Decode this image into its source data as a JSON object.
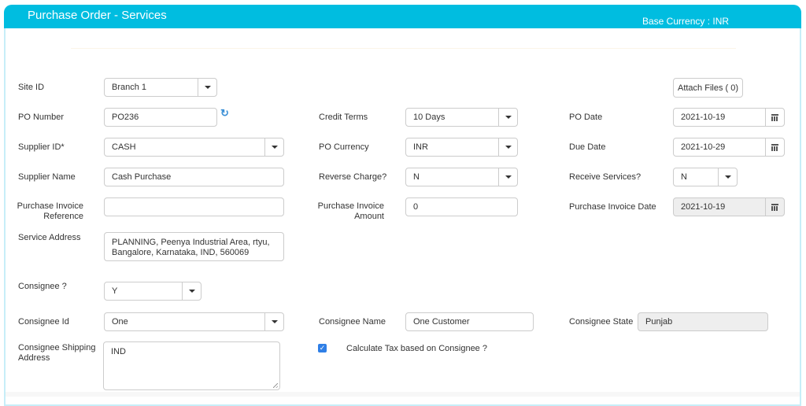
{
  "header": {
    "title": "Purchase Order - Services",
    "base_currency": "Base Currency  : INR"
  },
  "colors": {
    "header_bg": "#00bde0",
    "checkbox": "#2f7fe6",
    "refresh_icon": "#3a8fd6"
  },
  "toolbar": {
    "attach_files": "Attach Files ( 0)"
  },
  "form": {
    "site_id": {
      "label": "Site ID",
      "value": "Branch 1"
    },
    "po_number": {
      "label": "PO Number",
      "value": "PO236",
      "refresh_icon": "refresh-icon"
    },
    "supplier_id": {
      "label": "Supplier ID*",
      "value": "CASH"
    },
    "supplier_name": {
      "label": "Supplier Name",
      "value": "Cash Purchase"
    },
    "purchase_invoice_reference": {
      "label_line1": "Purchase Invoice",
      "label_line2": "Reference",
      "value": ""
    },
    "service_address": {
      "label": "Service Address",
      "line1": "PLANNING, Peenya Industrial Area, rtyu,",
      "line2": "Bangalore, Karnataka, IND, 560069"
    },
    "consignee": {
      "label": "Consignee ?",
      "value": "Y"
    },
    "consignee_id": {
      "label": "Consignee Id",
      "value": "One"
    },
    "consignee_shipping_address": {
      "label_line1": "Consignee Shipping",
      "label_line2": "Address",
      "value": "IND"
    },
    "credit_terms": {
      "label": "Credit Terms",
      "value": "10 Days"
    },
    "po_currency": {
      "label": "PO Currency",
      "value": "INR"
    },
    "reverse_charge": {
      "label": "Reverse Charge?",
      "value": "N"
    },
    "purchase_invoice_amount": {
      "label_line1": "Purchase Invoice",
      "label_line2": "Amount",
      "value": "0"
    },
    "consignee_name": {
      "label": "Consignee Name",
      "value": "One Customer"
    },
    "calculate_tax": {
      "label": "Calculate Tax based on Consignee ?",
      "checked": true
    },
    "po_date": {
      "label": "PO Date",
      "value": "2021-10-19"
    },
    "due_date": {
      "label": "Due Date",
      "value": "2021-10-29"
    },
    "receive_services": {
      "label": "Receive Services?",
      "value": "N"
    },
    "purchase_invoice_date": {
      "label": "Purchase Invoice Date",
      "value": "2021-10-19"
    },
    "consignee_state": {
      "label": "Consignee State",
      "value": "Punjab"
    }
  }
}
